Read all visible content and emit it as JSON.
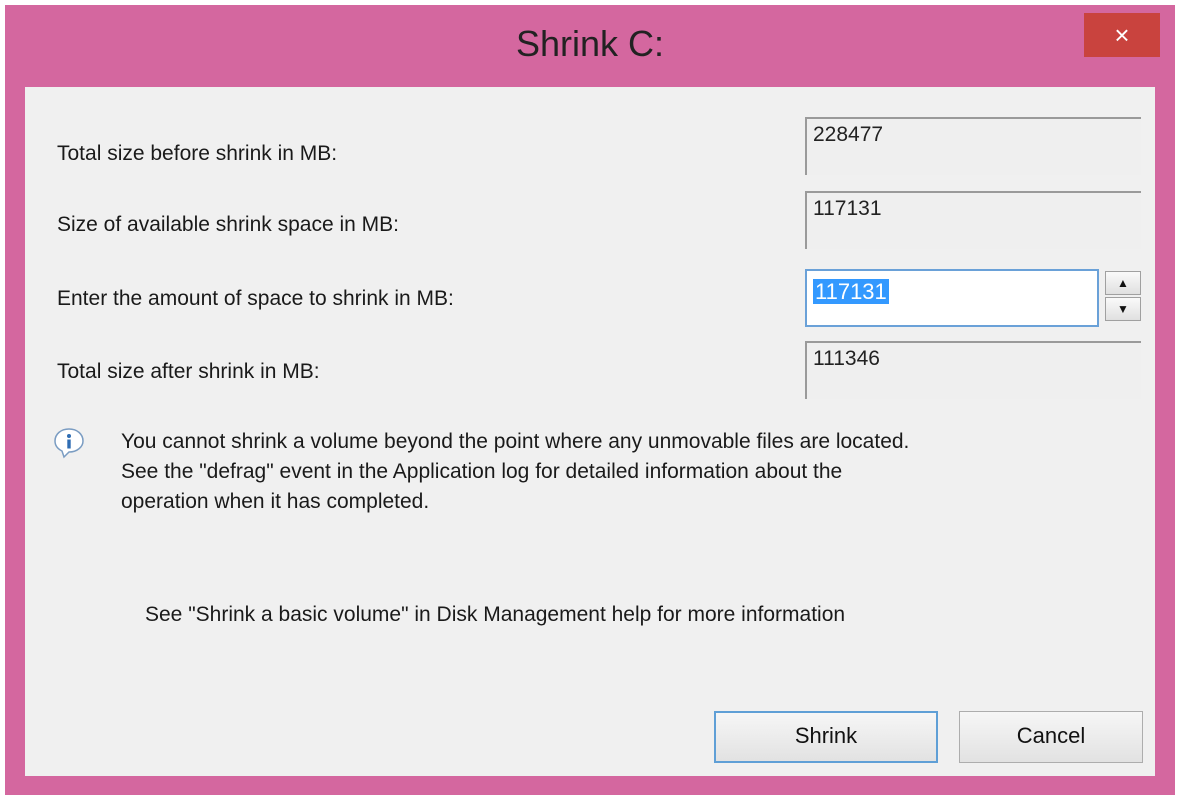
{
  "window": {
    "title": "Shrink C:",
    "close_label": "×"
  },
  "fields": {
    "total_before_label": "Total size before shrink in MB:",
    "total_before_value": "228477",
    "available_label": "Size of available shrink space in MB:",
    "available_value": "117131",
    "amount_label": "Enter the amount of space to shrink in MB:",
    "amount_value": "117131",
    "total_after_label": "Total size after shrink in MB:",
    "total_after_value": "111346"
  },
  "spinner": {
    "up_glyph": "▲",
    "down_glyph": "▼"
  },
  "info": {
    "icon": "info-icon",
    "message": "You cannot shrink a volume beyond the point where any unmovable files are located.\nSee the \"defrag\" event in the Application log for detailed information about the\noperation when it has completed."
  },
  "help": {
    "text": "See \"Shrink a basic volume\" in Disk Management help for more information"
  },
  "buttons": {
    "shrink_label": "Shrink",
    "cancel_label": "Cancel"
  },
  "colors": {
    "window_frame": "#d4679f",
    "close_button": "#c9433e",
    "selection": "#3399ff",
    "focus_border": "#5f9fd6"
  }
}
